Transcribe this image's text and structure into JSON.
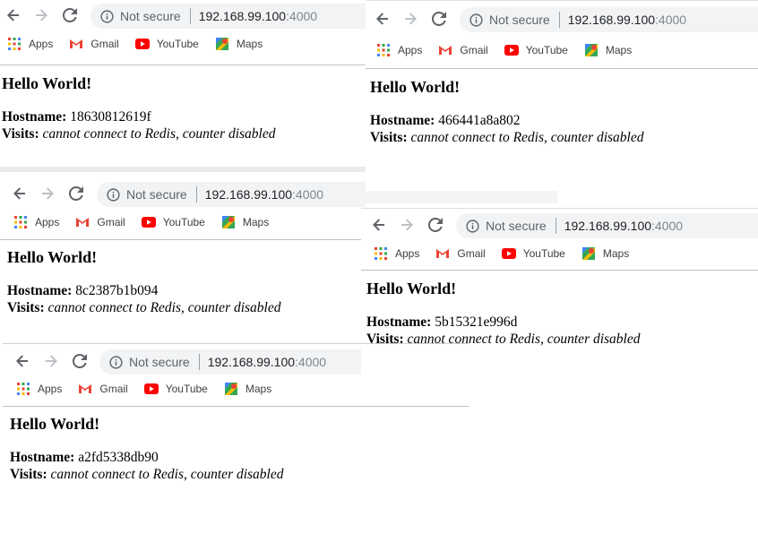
{
  "windows": [
    {
      "nav": {
        "back_icon": "arrow-left-icon",
        "forward_icon": "arrow-right-icon",
        "reload_icon": "reload-icon"
      },
      "url": {
        "security_text": "Not secure",
        "host": "192.168.99.100",
        "port": ":4000"
      },
      "bookmarks": [
        "Apps",
        "Gmail",
        "YouTube",
        "Maps"
      ],
      "page": {
        "heading": "Hello World!",
        "hostname_label": "Hostname:",
        "hostname_value": "18630812619f",
        "visits_label": "Visits:",
        "visits_value": "cannot connect to Redis, counter disabled"
      }
    },
    {
      "nav": {
        "back_icon": "arrow-left-icon",
        "forward_icon": "arrow-right-icon",
        "reload_icon": "reload-icon"
      },
      "url": {
        "security_text": "Not secure",
        "host": "192.168.99.100",
        "port": ":4000"
      },
      "bookmarks": [
        "Apps",
        "Gmail",
        "YouTube",
        "Maps"
      ],
      "page": {
        "heading": "Hello World!",
        "hostname_label": "Hostname:",
        "hostname_value": "466441a8a802",
        "visits_label": "Visits:",
        "visits_value": "cannot connect to Redis, counter disabled"
      }
    },
    {
      "nav": {
        "back_icon": "arrow-left-icon",
        "forward_icon": "arrow-right-icon",
        "reload_icon": "reload-icon"
      },
      "url": {
        "security_text": "Not secure",
        "host": "192.168.99.100",
        "port": ":4000"
      },
      "bookmarks": [
        "Apps",
        "Gmail",
        "YouTube",
        "Maps"
      ],
      "page": {
        "heading": "Hello World!",
        "hostname_label": "Hostname:",
        "hostname_value": "8c2387b1b094",
        "visits_label": "Visits:",
        "visits_value": "cannot connect to Redis, counter disabled"
      }
    },
    {
      "nav": {
        "back_icon": "arrow-left-icon",
        "forward_icon": "arrow-right-icon",
        "reload_icon": "reload-icon"
      },
      "url": {
        "security_text": "Not secure",
        "host": "192.168.99.100",
        "port": ":4000"
      },
      "bookmarks": [
        "Apps",
        "Gmail",
        "YouTube",
        "Maps"
      ],
      "page": {
        "heading": "Hello World!",
        "hostname_label": "Hostname:",
        "hostname_value": "5b15321e996d",
        "visits_label": "Visits:",
        "visits_value": "cannot connect to Redis, counter disabled"
      }
    },
    {
      "nav": {
        "back_icon": "arrow-left-icon",
        "forward_icon": "arrow-right-icon",
        "reload_icon": "reload-icon"
      },
      "url": {
        "security_text": "Not secure",
        "host": "192.168.99.100",
        "port": ":4000"
      },
      "bookmarks": [
        "Apps",
        "Gmail",
        "YouTube",
        "Maps"
      ],
      "page": {
        "heading": "Hello World!",
        "hostname_label": "Hostname:",
        "hostname_value": "a2fd5338db90",
        "visits_label": "Visits:",
        "visits_value": "cannot connect to Redis, counter disabled"
      }
    }
  ],
  "colors": {
    "omnibox_bg": "#f1f3f4",
    "gmail_red": "#ea4335",
    "youtube_red": "#ff0000",
    "divider": "#bdc1c6"
  }
}
